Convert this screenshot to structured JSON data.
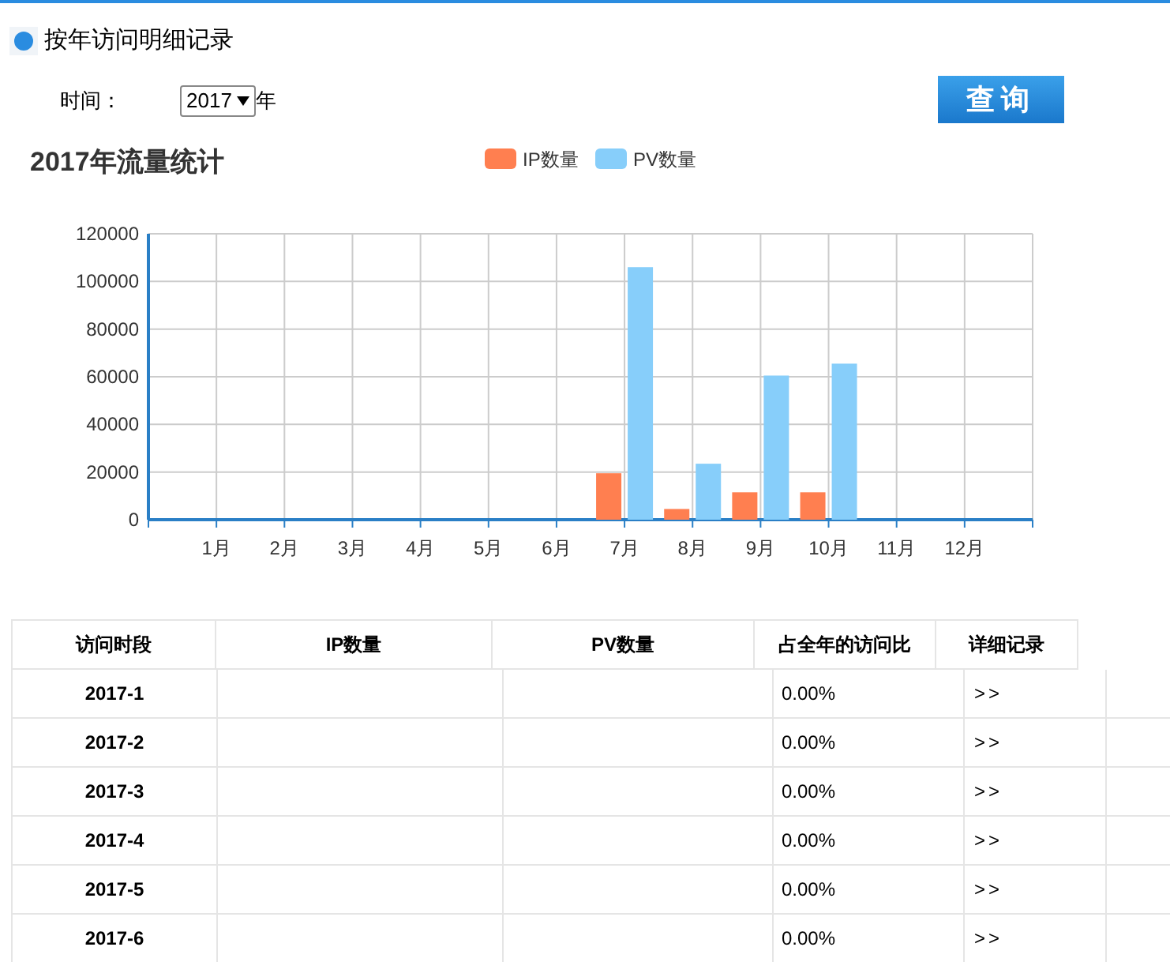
{
  "header": {
    "title": "按年访问明细记录"
  },
  "filter": {
    "label": "时间：",
    "year": "2017",
    "unit": "年",
    "button": "查询"
  },
  "chart": {
    "title": "2017年流量统计",
    "chart_data": {
      "type": "bar",
      "categories": [
        "1月",
        "2月",
        "3月",
        "4月",
        "5月",
        "6月",
        "7月",
        "8月",
        "9月",
        "10月",
        "11月",
        "12月"
      ],
      "series": [
        {
          "name": "IP数量",
          "color": "#ff7f50",
          "values": [
            0,
            0,
            0,
            0,
            0,
            0,
            19500,
            4500,
            11500,
            11500,
            0,
            0
          ]
        },
        {
          "name": "PV数量",
          "color": "#87cefa",
          "values": [
            0,
            0,
            0,
            0,
            0,
            0,
            106000,
            23500,
            60500,
            65500,
            0,
            0
          ]
        }
      ],
      "grid": true,
      "legend": true,
      "ylim": [
        0,
        120000
      ],
      "yticks": [
        0,
        20000,
        40000,
        60000,
        80000,
        100000,
        120000
      ]
    }
  },
  "table": {
    "columns": [
      "访问时段",
      "IP数量",
      "PV数量",
      "占全年的访问比",
      "详细记录"
    ],
    "rows": [
      {
        "period": "2017-1",
        "share": "0.00%",
        "link": ">>"
      },
      {
        "period": "2017-2",
        "share": "0.00%",
        "link": ">>"
      },
      {
        "period": "2017-3",
        "share": "0.00%",
        "link": ">>"
      },
      {
        "period": "2017-4",
        "share": "0.00%",
        "link": ">>"
      },
      {
        "period": "2017-5",
        "share": "0.00%",
        "link": ">>"
      },
      {
        "period": "2017-6",
        "share": "0.00%",
        "link": ">>"
      }
    ]
  }
}
